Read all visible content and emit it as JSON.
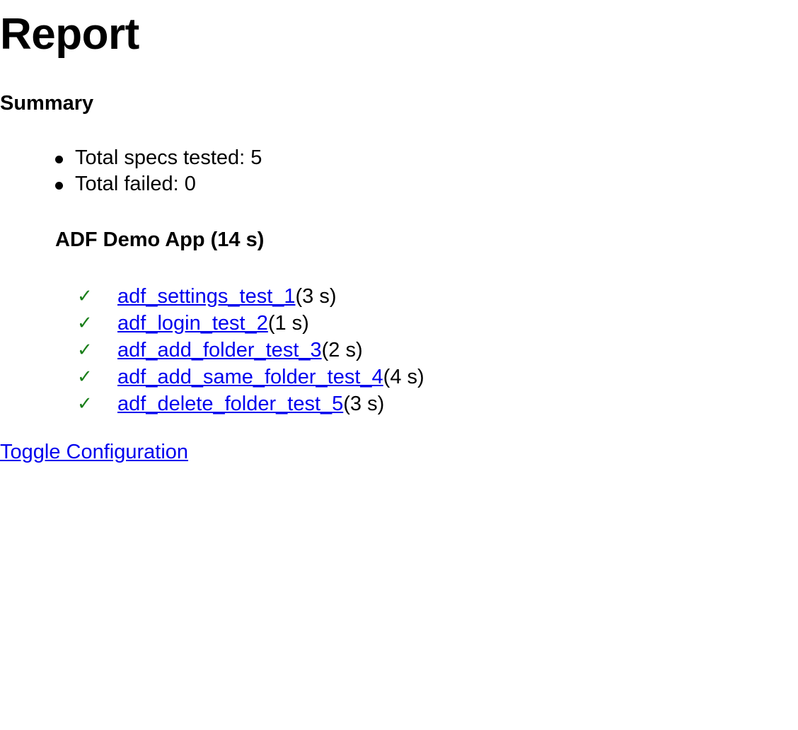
{
  "page": {
    "title": "Report"
  },
  "summary": {
    "title": "Summary",
    "items": [
      {
        "label": "Total specs tested: 5"
      },
      {
        "label": "Total failed: 0"
      }
    ]
  },
  "suite": {
    "title": "ADF Demo App (14 s)",
    "specs": [
      {
        "name": "adf_settings_test_1",
        "duration": "(3 s)",
        "status": "passed",
        "icon": "checkmark-icon"
      },
      {
        "name": "adf_login_test_2",
        "duration": "(1 s)",
        "status": "passed",
        "icon": "checkmark-icon"
      },
      {
        "name": "adf_add_folder_test_3",
        "duration": "(2 s)",
        "status": "passed",
        "icon": "checkmark-icon"
      },
      {
        "name": "adf_add_same_folder_test_4",
        "duration": "(4 s)",
        "status": "passed",
        "icon": "checkmark-icon"
      },
      {
        "name": "adf_delete_folder_test_5",
        "duration": "(3 s)",
        "status": "passed",
        "icon": "checkmark-icon"
      }
    ],
    "check_glyph": "✓",
    "check_color": "#1a7f1a"
  },
  "footer": {
    "toggle_label": "Toggle Configuration"
  },
  "colors": {
    "link": "#0000ee",
    "text": "#000000",
    "background": "#ffffff"
  }
}
